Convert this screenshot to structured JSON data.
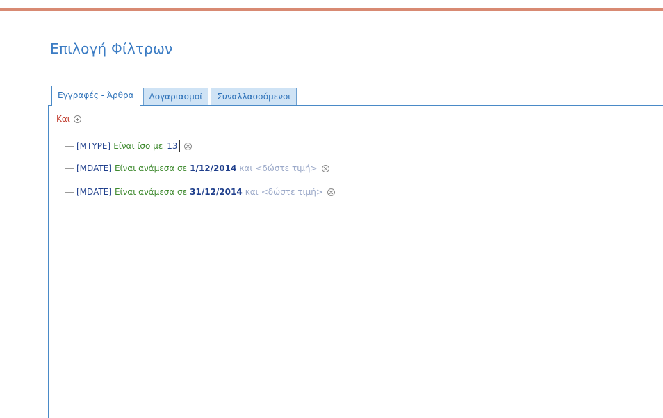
{
  "page": {
    "title": "Επιλογή Φίλτρων"
  },
  "tabs": [
    {
      "label": "Εγγραφές - Άρθρα",
      "active": true
    },
    {
      "label": "Λογαριασμοί",
      "active": false
    },
    {
      "label": "Συναλλασσόμενοι",
      "active": false
    }
  ],
  "filter": {
    "root_operator": "Και",
    "conditions": [
      {
        "field": "[MTYPE]",
        "operator": "Είναι ίσο με",
        "value": "13"
      },
      {
        "field": "[MDATE]",
        "operator": "Είναι ανάμεσα σε",
        "value": "1/12/2014",
        "joiner": "και",
        "value2_placeholder": "<δώστε τιμή>"
      },
      {
        "field": "[MDATE]",
        "operator": "Είναι ανάμεσα σε",
        "value": "31/12/2014",
        "joiner": "και",
        "value2_placeholder": "<δώστε τιμή>"
      }
    ]
  },
  "colors": {
    "accent_rule": "#d88a73",
    "title_blue": "#3b7cc4",
    "root_operator_red": "#c0392b",
    "operator_green": "#3f8a2f"
  },
  "icons": {
    "add": "add-condition-icon",
    "remove": "remove-condition-icon"
  }
}
